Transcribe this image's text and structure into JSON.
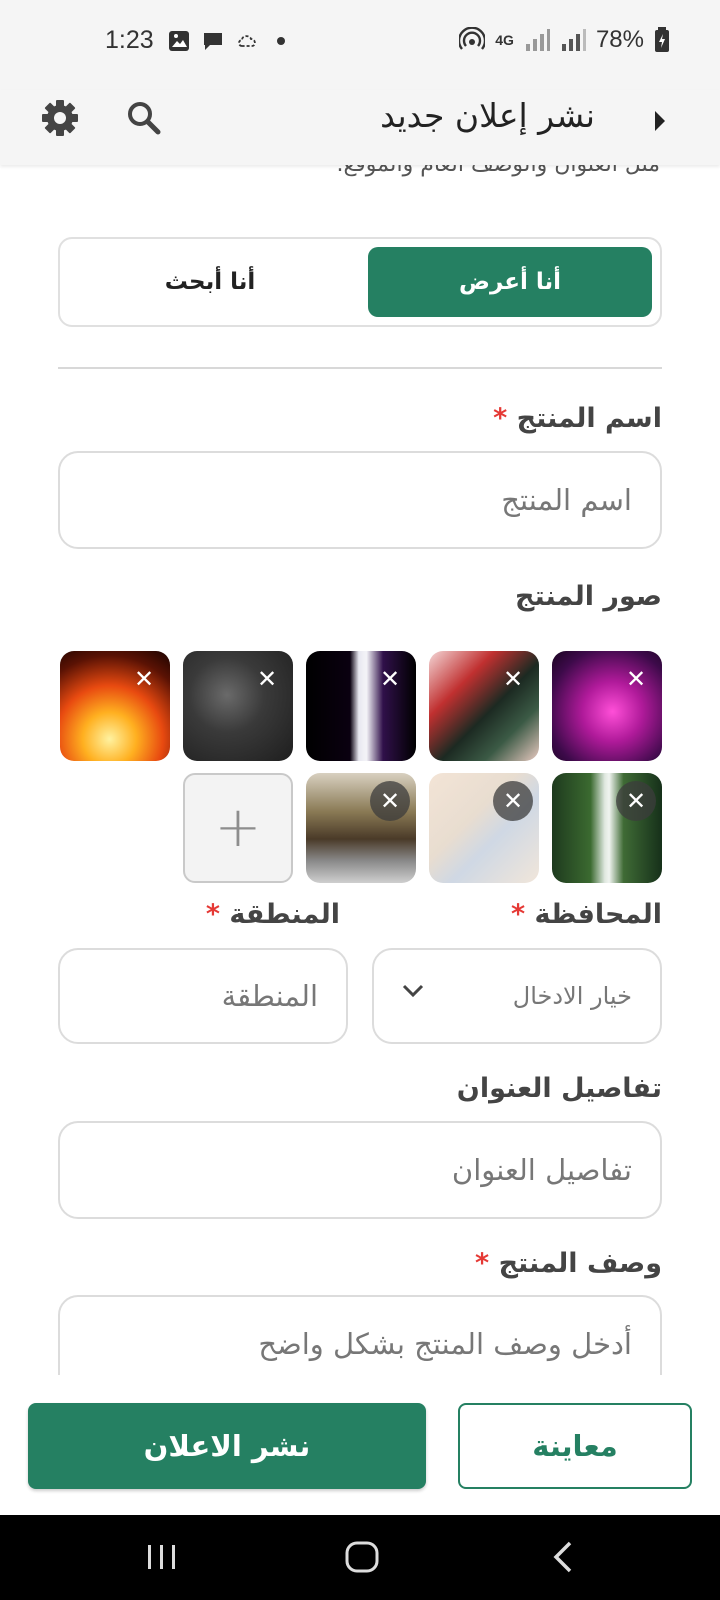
{
  "status_bar": {
    "time": "1:23",
    "network": "4G",
    "battery": "78%"
  },
  "app_bar": {
    "title": "نشر إعلان جديد"
  },
  "intro": {
    "text": "مثل العنوان والوصف العام والموقع."
  },
  "listing_type": {
    "offer_label": "أنا أعرض",
    "search_label": "أنا أبحث",
    "selected": "أنا أعرض"
  },
  "product_name": {
    "label": "اسم المنتج",
    "required_mark": "*",
    "placeholder": "اسم المنتج"
  },
  "product_photos": {
    "label": "صور المنتج",
    "close_glyph": "✕",
    "add_glyph": "+"
  },
  "governorate": {
    "label": "المحافظة",
    "required_mark": "*",
    "selected_value": "خيار الادخال"
  },
  "region": {
    "label": "المنطقة",
    "required_mark": "*",
    "placeholder": "المنطقة"
  },
  "address_details": {
    "label": "تفاصيل العنوان",
    "placeholder": "تفاصيل العنوان"
  },
  "product_description": {
    "label": "وصف المنتج",
    "required_mark": "*",
    "placeholder": "أدخل وصف المنتج بشكل واضح"
  },
  "actions": {
    "publish_label": "نشر الاعلان",
    "preview_label": "معاينة"
  },
  "colors": {
    "primary": "#258062",
    "required": "#e53935",
    "app_bar": "#f5f5f5"
  }
}
